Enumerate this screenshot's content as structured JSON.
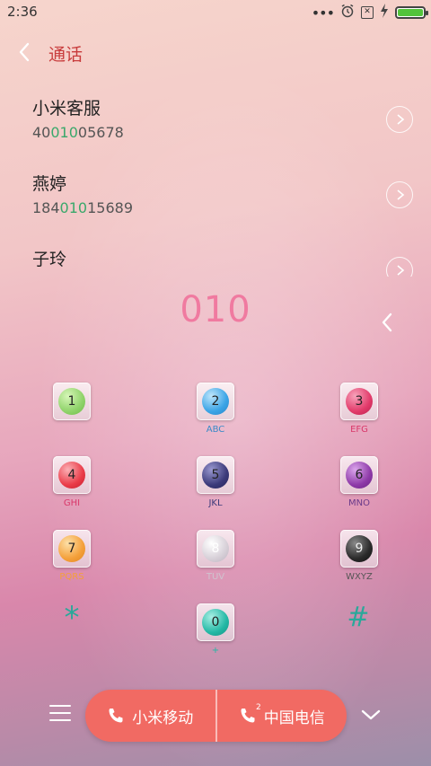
{
  "status_bar": {
    "time": "2:36",
    "icons": [
      "more-dots-icon",
      "alarm-icon",
      "no-sim-icon",
      "charging-icon",
      "battery-icon"
    ],
    "battery_color": "#53c33c"
  },
  "header": {
    "back_icon": "chevron-left-icon",
    "title": "通话",
    "title_color": "#c83c3c"
  },
  "contacts": [
    {
      "name": "小米客服",
      "number_prefix": "40",
      "number_match": "010",
      "number_suffix": "05678"
    },
    {
      "name": "燕婷",
      "number_prefix": "184",
      "number_match": "010",
      "number_suffix": "15689"
    },
    {
      "name": "子玲",
      "number_prefix": "",
      "number_match": "",
      "number_suffix": ""
    }
  ],
  "dial": {
    "number": "010",
    "number_color": "#f07aa0",
    "delete_icon": "backspace-chevron-icon"
  },
  "keypad": {
    "keys": [
      {
        "digit": "1",
        "letters": "",
        "color": "#8fd36a"
      },
      {
        "digit": "2",
        "letters": "ABC",
        "color": "#3aa4e6"
      },
      {
        "digit": "3",
        "letters": "EFG",
        "color": "#e23a6a"
      },
      {
        "digit": "4",
        "letters": "GHI",
        "color": "#ea3b48"
      },
      {
        "digit": "5",
        "letters": "JKL",
        "color": "#3b3a7a"
      },
      {
        "digit": "6",
        "letters": "MNO",
        "color": "#8e3aa8"
      },
      {
        "digit": "7",
        "letters": "PQRS",
        "color": "#f4a03a"
      },
      {
        "digit": "8",
        "letters": "TUV",
        "color": "#d7d0d8"
      },
      {
        "digit": "9",
        "letters": "WXYZ",
        "color": "#2a2a2a"
      },
      {
        "digit": "0",
        "letters": "+",
        "color": "#23b8a5"
      }
    ],
    "star": "*",
    "hash": "#"
  },
  "bottom_bar": {
    "menu_icon": "hamburger-menu-icon",
    "sim1_label": "小米移动",
    "sim2_label": "中国电信",
    "sim2_index": "2",
    "call_color": "#f16a63",
    "collapse_icon": "chevron-down-icon"
  }
}
